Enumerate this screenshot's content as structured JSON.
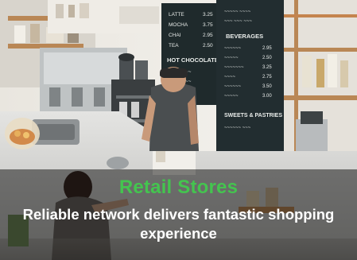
{
  "photo": {
    "subject": "cafe-counter-with-barista-and-customer",
    "colors": {
      "chalkboard": "#1f2a2c",
      "wall": "#f3f1ec",
      "counter": "#d9d9d6",
      "wood_shelf": "#b98755",
      "barista_shirt": "#4a4e50",
      "beanie": "#2a2a2a"
    },
    "chalkboard_left": {
      "items": [
        {
          "name": "LATTE",
          "price": "3.25"
        },
        {
          "name": "MOCHA",
          "price": "3.75"
        },
        {
          "name": "CHAI",
          "price": "2.95"
        },
        {
          "name": "TEA",
          "price": "2.50"
        }
      ],
      "heading": "HOT CHOCOLATE"
    },
    "chalkboard_right": {
      "heading": "BEVERAGES",
      "footer": "SWEETS & PASTRIES"
    }
  },
  "caption": {
    "title": "Retail Stores",
    "subtitle": "Reliable network delivers fantastic shopping experience",
    "title_color": "#44c44f",
    "subtitle_color": "#ffffff"
  }
}
